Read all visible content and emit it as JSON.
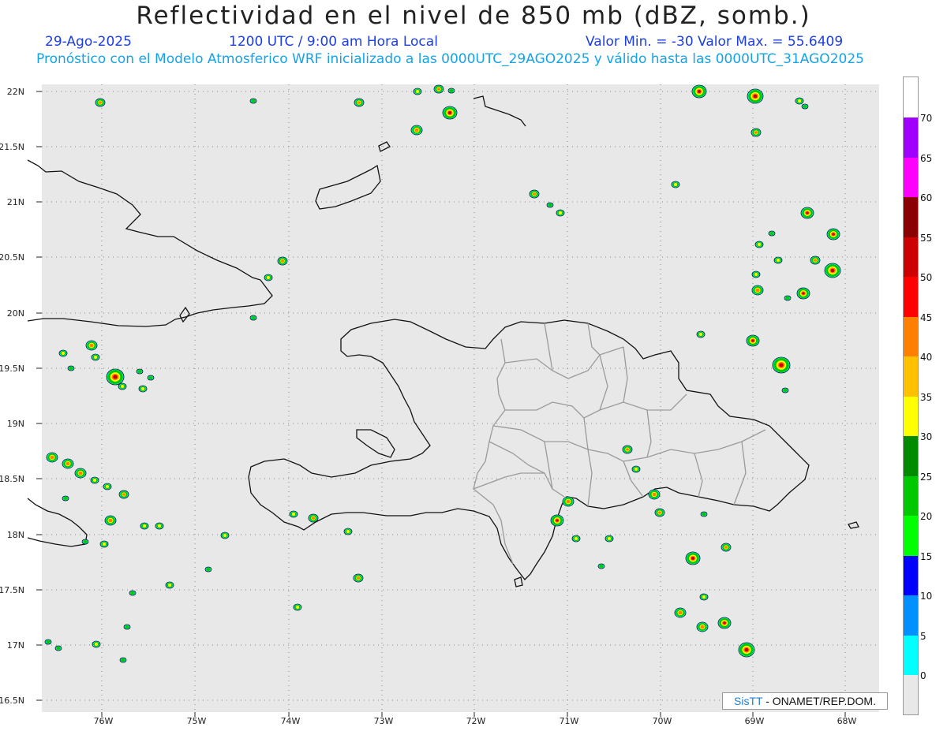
{
  "header": {
    "title": "Reflectividad en el nivel de 850 mb (dBZ, somb.)",
    "date": "29-Ago-2025",
    "time": "1200 UTC / 9:00 am Hora Local",
    "minmax": "Valor Min. = -30  Valor Max. = 55.6409",
    "model_line": "Pronóstico con el Modelo Atmosferico WRF inicializado a las 0000UTC_29AGO2025 y válido hasta las  0000UTC_31AGO2025"
  },
  "map": {
    "lat_labels": [
      "22N",
      "21.5N",
      "21N",
      "20.5N",
      "20N",
      "19.5N",
      "19N",
      "18.5N",
      "18N",
      "17.5N",
      "17N",
      "16.5N"
    ],
    "lon_labels": [
      "76W",
      "75W",
      "74W",
      "73W",
      "72W",
      "71W",
      "70W",
      "69W",
      "68W"
    ],
    "background_color": "#e8e8e8"
  },
  "colorbar": {
    "labels": [
      "70",
      "65",
      "60",
      "55",
      "50",
      "45",
      "40",
      "35",
      "30",
      "25",
      "20",
      "15",
      "10",
      "5",
      "0"
    ],
    "colors": [
      "#a000ff",
      "#ff00ff",
      "#8b0000",
      "#cc0000",
      "#ff0000",
      "#ff7f00",
      "#ffc000",
      "#ffff00",
      "#008a00",
      "#00c800",
      "#00ff00",
      "#0000ff",
      "#0090ff",
      "#00ffff",
      "#e8e8e8"
    ]
  },
  "credit": {
    "sis": "SisTT",
    "text": "- ONAMET/REP.DOM."
  }
}
